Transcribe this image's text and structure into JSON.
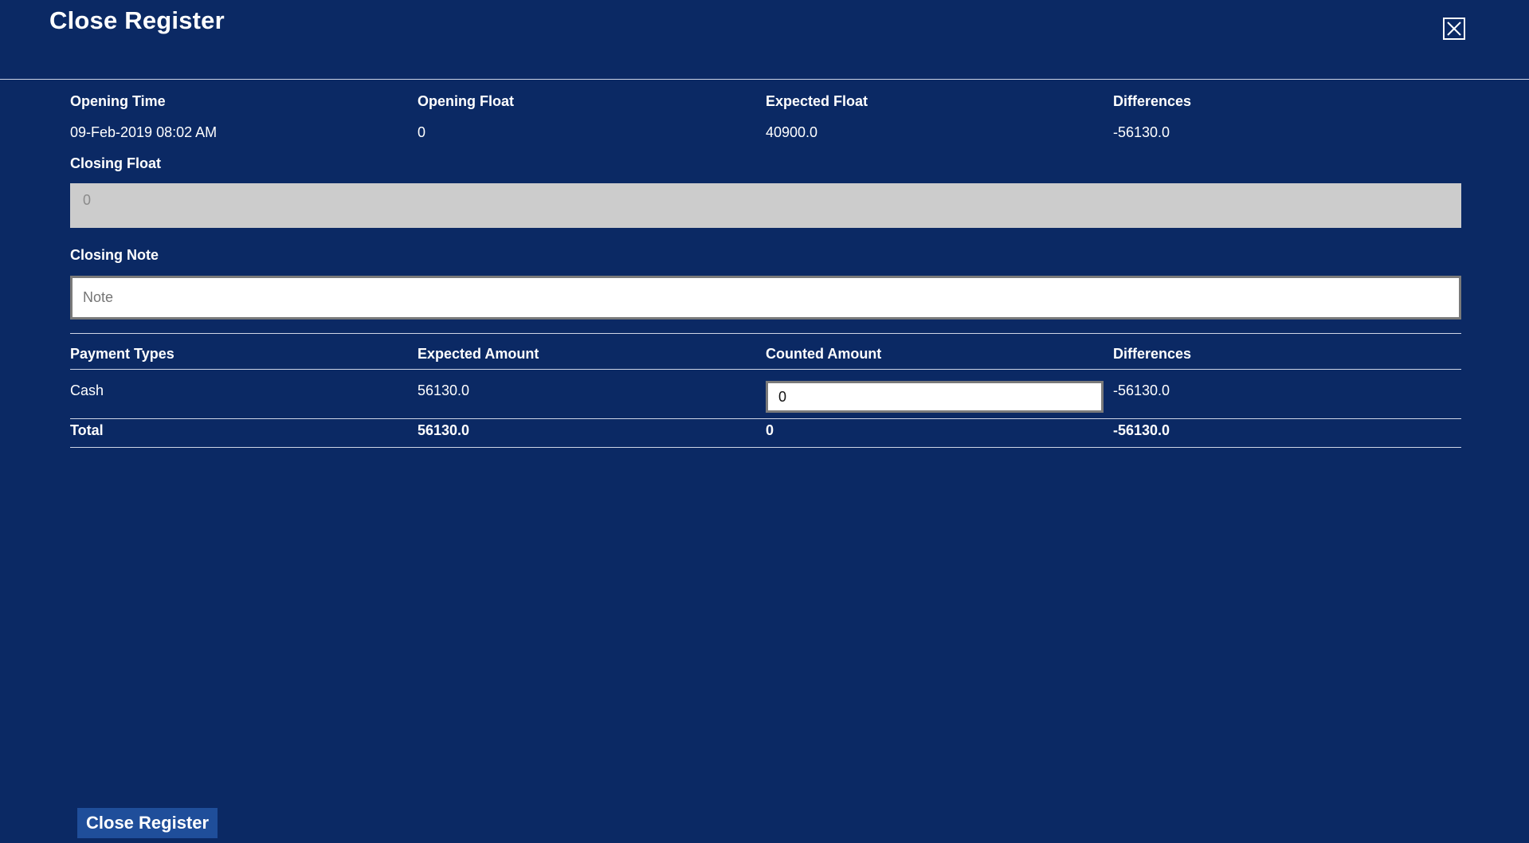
{
  "dialog": {
    "title": "Close Register",
    "close_icon": "close-icon"
  },
  "summary": {
    "headers": [
      "Opening Time",
      "Opening Float",
      "Expected Float",
      "Differences"
    ],
    "values": [
      "09-Feb-2019 08:02 AM",
      "0",
      "40900.0",
      "-56130.0"
    ]
  },
  "closing_float": {
    "label": "Closing Float",
    "value": "0"
  },
  "closing_note": {
    "label": "Closing Note",
    "placeholder": "Note",
    "value": ""
  },
  "payments": {
    "headers": [
      "Payment Types",
      "Expected Amount",
      "Counted Amount",
      "Differences"
    ],
    "rows": [
      {
        "type": "Cash",
        "expected": "56130.0",
        "counted": "0",
        "difference": "-56130.0"
      }
    ],
    "total": {
      "label": "Total",
      "expected": "56130.0",
      "counted": "0",
      "difference": "-56130.0"
    }
  },
  "footer": {
    "close_register_label": "Close Register"
  },
  "colors": {
    "background": "#0b2964",
    "button": "#1f4e9a",
    "disabled_input": "#cccccc"
  }
}
